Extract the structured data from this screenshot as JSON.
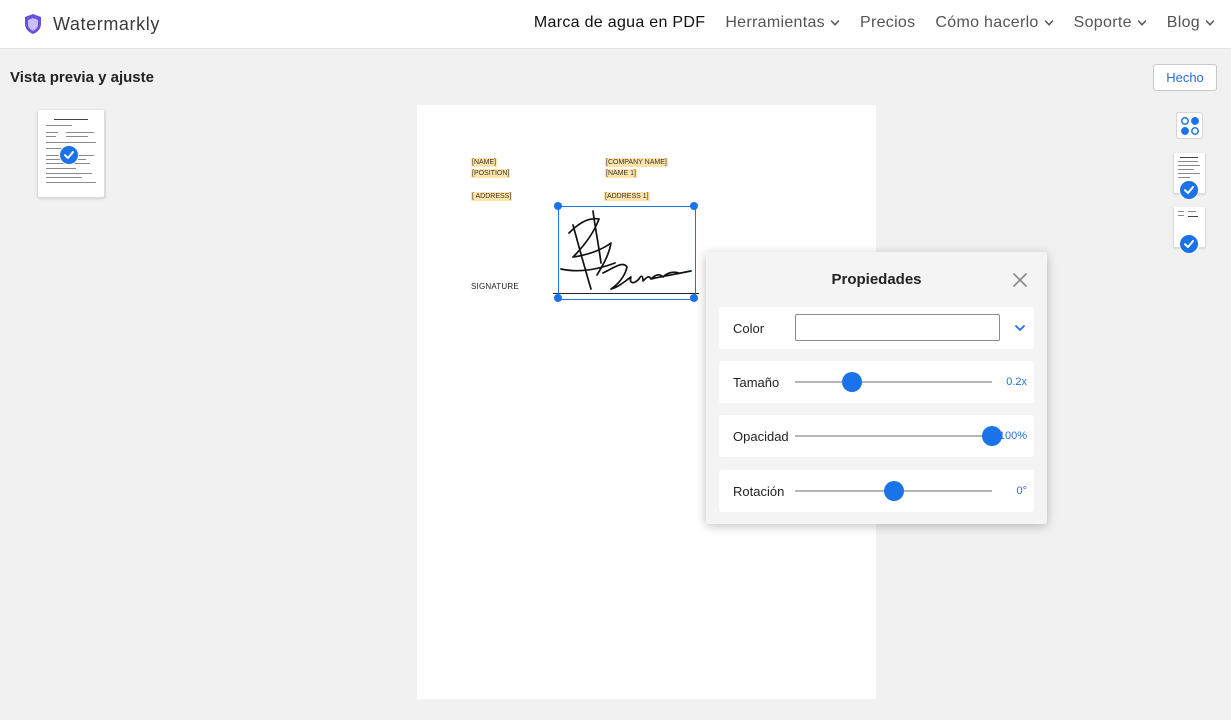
{
  "brand": {
    "name": "Watermarkly",
    "logo_icon": "shield-logo-icon"
  },
  "nav": {
    "items": [
      {
        "label": "Marca de agua en PDF",
        "dropdown": false,
        "active": true
      },
      {
        "label": "Herramientas",
        "dropdown": true,
        "active": false
      },
      {
        "label": "Precios",
        "dropdown": false,
        "active": false
      },
      {
        "label": "Cómo hacerlo",
        "dropdown": true,
        "active": false
      },
      {
        "label": "Soporte",
        "dropdown": true,
        "active": false
      },
      {
        "label": "Blog",
        "dropdown": true,
        "active": false
      }
    ]
  },
  "header": {
    "title": "Vista previa y ajuste",
    "done_label": "Hecho"
  },
  "document": {
    "placeholders": {
      "name": "[NAME]",
      "position": "[POSITION]",
      "address": "[ ADDRESS]",
      "company_name": "[COMPANY NAME]",
      "name_1": "[NAME 1]",
      "address_1": "[ADDRESS 1]"
    },
    "signature_label": "SIGNATURE"
  },
  "properties": {
    "title": "Propiedades",
    "color": {
      "label": "Color",
      "value": ""
    },
    "size": {
      "label": "Tamaño",
      "value": "0.2x",
      "position": 0.29
    },
    "opacity": {
      "label": "Opacidad",
      "value": "100%",
      "position": 1.0
    },
    "rotation": {
      "label": "Rotación",
      "value": "0°",
      "position": 0.5
    }
  },
  "colors": {
    "accent": "#1a73e8",
    "highlight": "#ffe3a8",
    "background": "#f1f1f1"
  }
}
